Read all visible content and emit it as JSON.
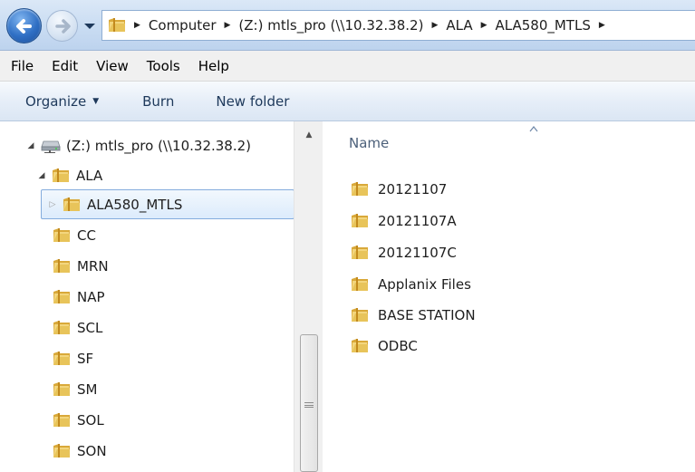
{
  "address_bar": {
    "breadcrumbs": [
      "Computer",
      "(Z:) mtls_pro (\\\\10.32.38.2)",
      "ALA",
      "ALA580_MTLS"
    ]
  },
  "menu": [
    "File",
    "Edit",
    "View",
    "Tools",
    "Help"
  ],
  "toolbar": {
    "organize": "Organize",
    "burn": "Burn",
    "new_folder": "New folder"
  },
  "nav_tree": {
    "drive": "(Z:) mtls_pro (\\\\10.32.38.2)",
    "parent": "ALA",
    "selected": "ALA580_MTLS",
    "siblings": [
      "CC",
      "MRN",
      "NAP",
      "SCL",
      "SF",
      "SM",
      "SOL",
      "SON"
    ]
  },
  "content": {
    "column_header": "Name",
    "items": [
      "20121107",
      "20121107A",
      "20121107C",
      "Applanix Files",
      "BASE STATION",
      "ODBC"
    ]
  },
  "colors": {
    "folder": "#e8c45a",
    "selection_border": "#84acdd",
    "header_text": "#4c607a"
  }
}
